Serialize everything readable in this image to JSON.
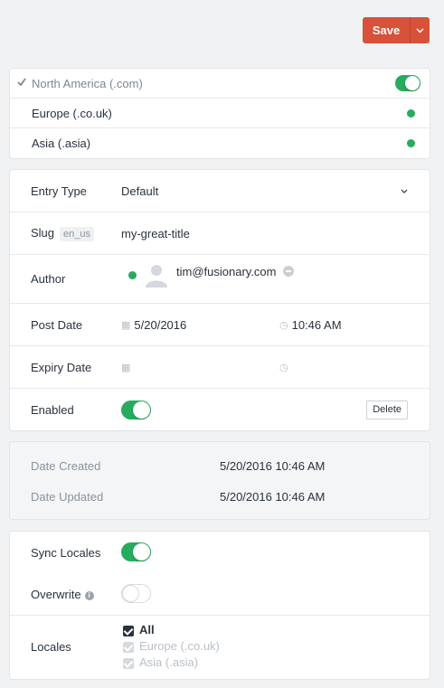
{
  "toolbar": {
    "save_label": "Save",
    "save_menu_icon": "chevron-down-icon"
  },
  "locales_pane": {
    "items": [
      {
        "label": "North America (.com)",
        "current": true,
        "enabled": true
      },
      {
        "label": "Europe (.co.uk)",
        "status": "enabled"
      },
      {
        "label": "Asia (.asia)",
        "status": "enabled"
      }
    ]
  },
  "meta": {
    "entry_type_label": "Entry Type",
    "entry_type_value": "Default",
    "slug_label": "Slug",
    "slug_locale": "en_us",
    "slug_value": "my-great-title",
    "author_label": "Author",
    "author_value": "tim@fusionary.com",
    "post_date_label": "Post Date",
    "post_date_value": "5/20/2016",
    "post_time_value": "10:46 AM",
    "expiry_date_label": "Expiry Date",
    "expiry_date_value": "",
    "expiry_time_value": "",
    "enabled_label": "Enabled",
    "enabled": true,
    "delete_label": "Delete"
  },
  "dates": {
    "created_label": "Date Created",
    "created_value": "5/20/2016 10:46 AM",
    "updated_label": "Date Updated",
    "updated_value": "5/20/2016 10:46 AM"
  },
  "sync": {
    "sync_label": "Sync Locales",
    "sync_enabled": true,
    "overwrite_label": "Overwrite",
    "overwrite_enabled": false,
    "locales_label": "Locales",
    "options": [
      {
        "label": "All",
        "checked": true,
        "disabled": false
      },
      {
        "label": "Europe (.co.uk)",
        "checked": true,
        "disabled": true
      },
      {
        "label": "Asia (.asia)",
        "checked": true,
        "disabled": true
      }
    ]
  },
  "colors": {
    "accent": "#d8513b",
    "enabled_green": "#27ab5f",
    "background": "#f1f2f4"
  }
}
